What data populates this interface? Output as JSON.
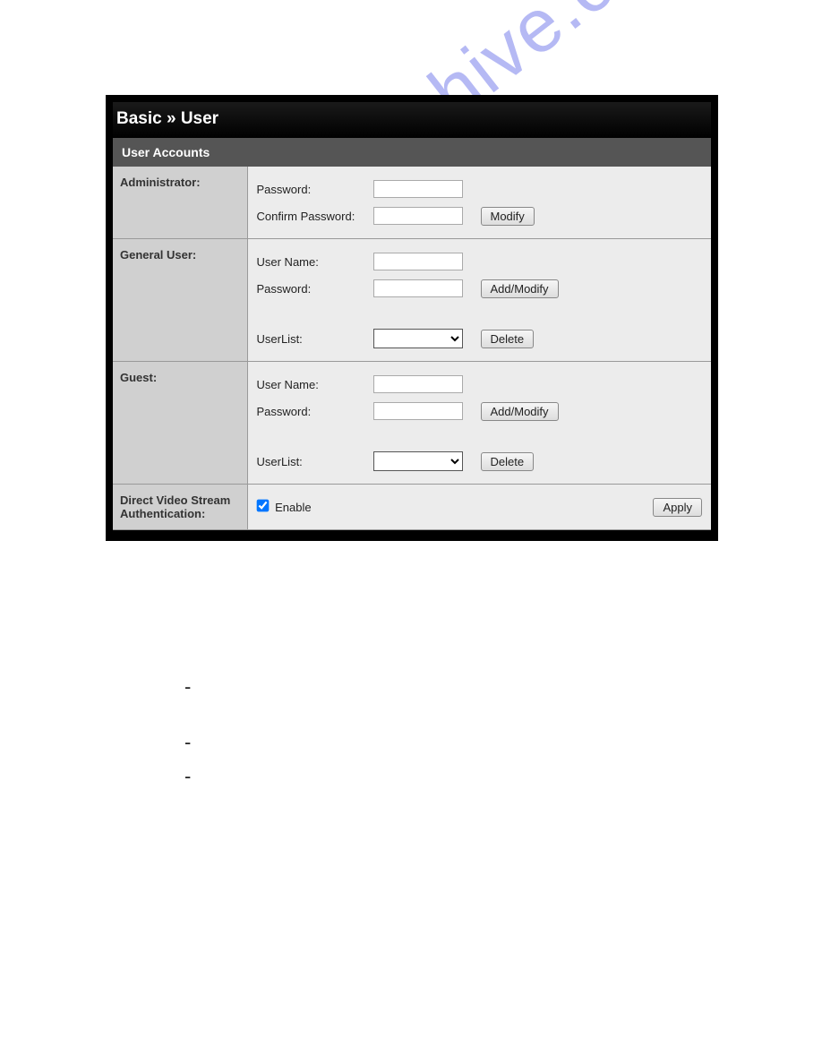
{
  "watermark": "manualshive.com",
  "panel": {
    "title": "Basic » User",
    "section_header": "User Accounts",
    "rows": {
      "admin": {
        "head": "Administrator:",
        "password_label": "Password:",
        "confirm_label": "Confirm Password:",
        "modify_btn": "Modify"
      },
      "general": {
        "head": "General User:",
        "username_label": "User Name:",
        "password_label": "Password:",
        "addmodify_btn": "Add/Modify",
        "userlist_label": "UserList:",
        "delete_btn": "Delete"
      },
      "guest": {
        "head": "Guest:",
        "username_label": "User Name:",
        "password_label": "Password:",
        "addmodify_btn": "Add/Modify",
        "userlist_label": "UserList:",
        "delete_btn": "Delete"
      },
      "dvs": {
        "head": "Direct Video Stream Authentication:",
        "enable_label": "Enable",
        "enable_checked": true,
        "apply_btn": "Apply"
      }
    }
  },
  "dashes": [
    "-",
    "-",
    "-"
  ]
}
